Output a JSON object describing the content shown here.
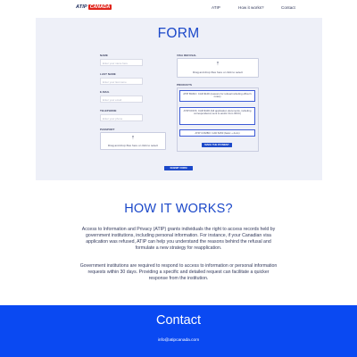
{
  "nav": {
    "logo_part1": "ATIP",
    "logo_part2": "CANADA",
    "links": [
      "ATIP",
      "How it works?",
      "Contact"
    ]
  },
  "form": {
    "title": "FORM",
    "fields": [
      {
        "label": "NAME",
        "placeholder": "Enter your name here"
      },
      {
        "label": "LAST NAME",
        "placeholder": "Enter your last name"
      },
      {
        "label": "E-MAIL",
        "placeholder": "Enter your email"
      },
      {
        "label": "TELEPHONE",
        "placeholder": "Enter your phone"
      }
    ],
    "passport": {
      "label": "PASSPORT",
      "drop_text": "Drag and drop files here or click to select",
      "icon": "upload-icon"
    },
    "visa_refusal": {
      "label": "VISA REFUSAL",
      "drop_text": "Drag and drop files here or click to select",
      "icon": "upload-icon"
    },
    "products": {
      "label": "PRODUCTS",
      "items": [
        "ATIP BASIC: CAD $100 (reasons for refusal including officer's notes)",
        "ATIP DOCS: CAD $100 (full application documents, including correspondence sent to and/or from IRCC)",
        "ATIP COMBO: CAD $150 (basic + docs)"
      ]
    },
    "make_payment_label": "MAKE THE PAYMENT",
    "submit_label": "SUBMIT FORM"
  },
  "how": {
    "title": "HOW IT WORKS?",
    "para1": "Access to Information and Privacy (ATIP) grants individuals the right to access records held by government institutions, including personal information. For instance, if your Canadian visa application was refused, ATIP can help you understand the reasons behind the refusal and formulate a new strategy for reapplication.",
    "para2": "Government institutions are required to respond to access to information or personal information requests within 30 days. Providing a specific and detailed request can facilitate a quicker response from the institution."
  },
  "contact": {
    "title": "Contact",
    "email": "info@atipcanada.com"
  },
  "colors": {
    "accent": "#1b48c9",
    "contact_bg": "#0a49f2",
    "form_bg": "#eef0f8",
    "logo_red": "#e0241b"
  }
}
